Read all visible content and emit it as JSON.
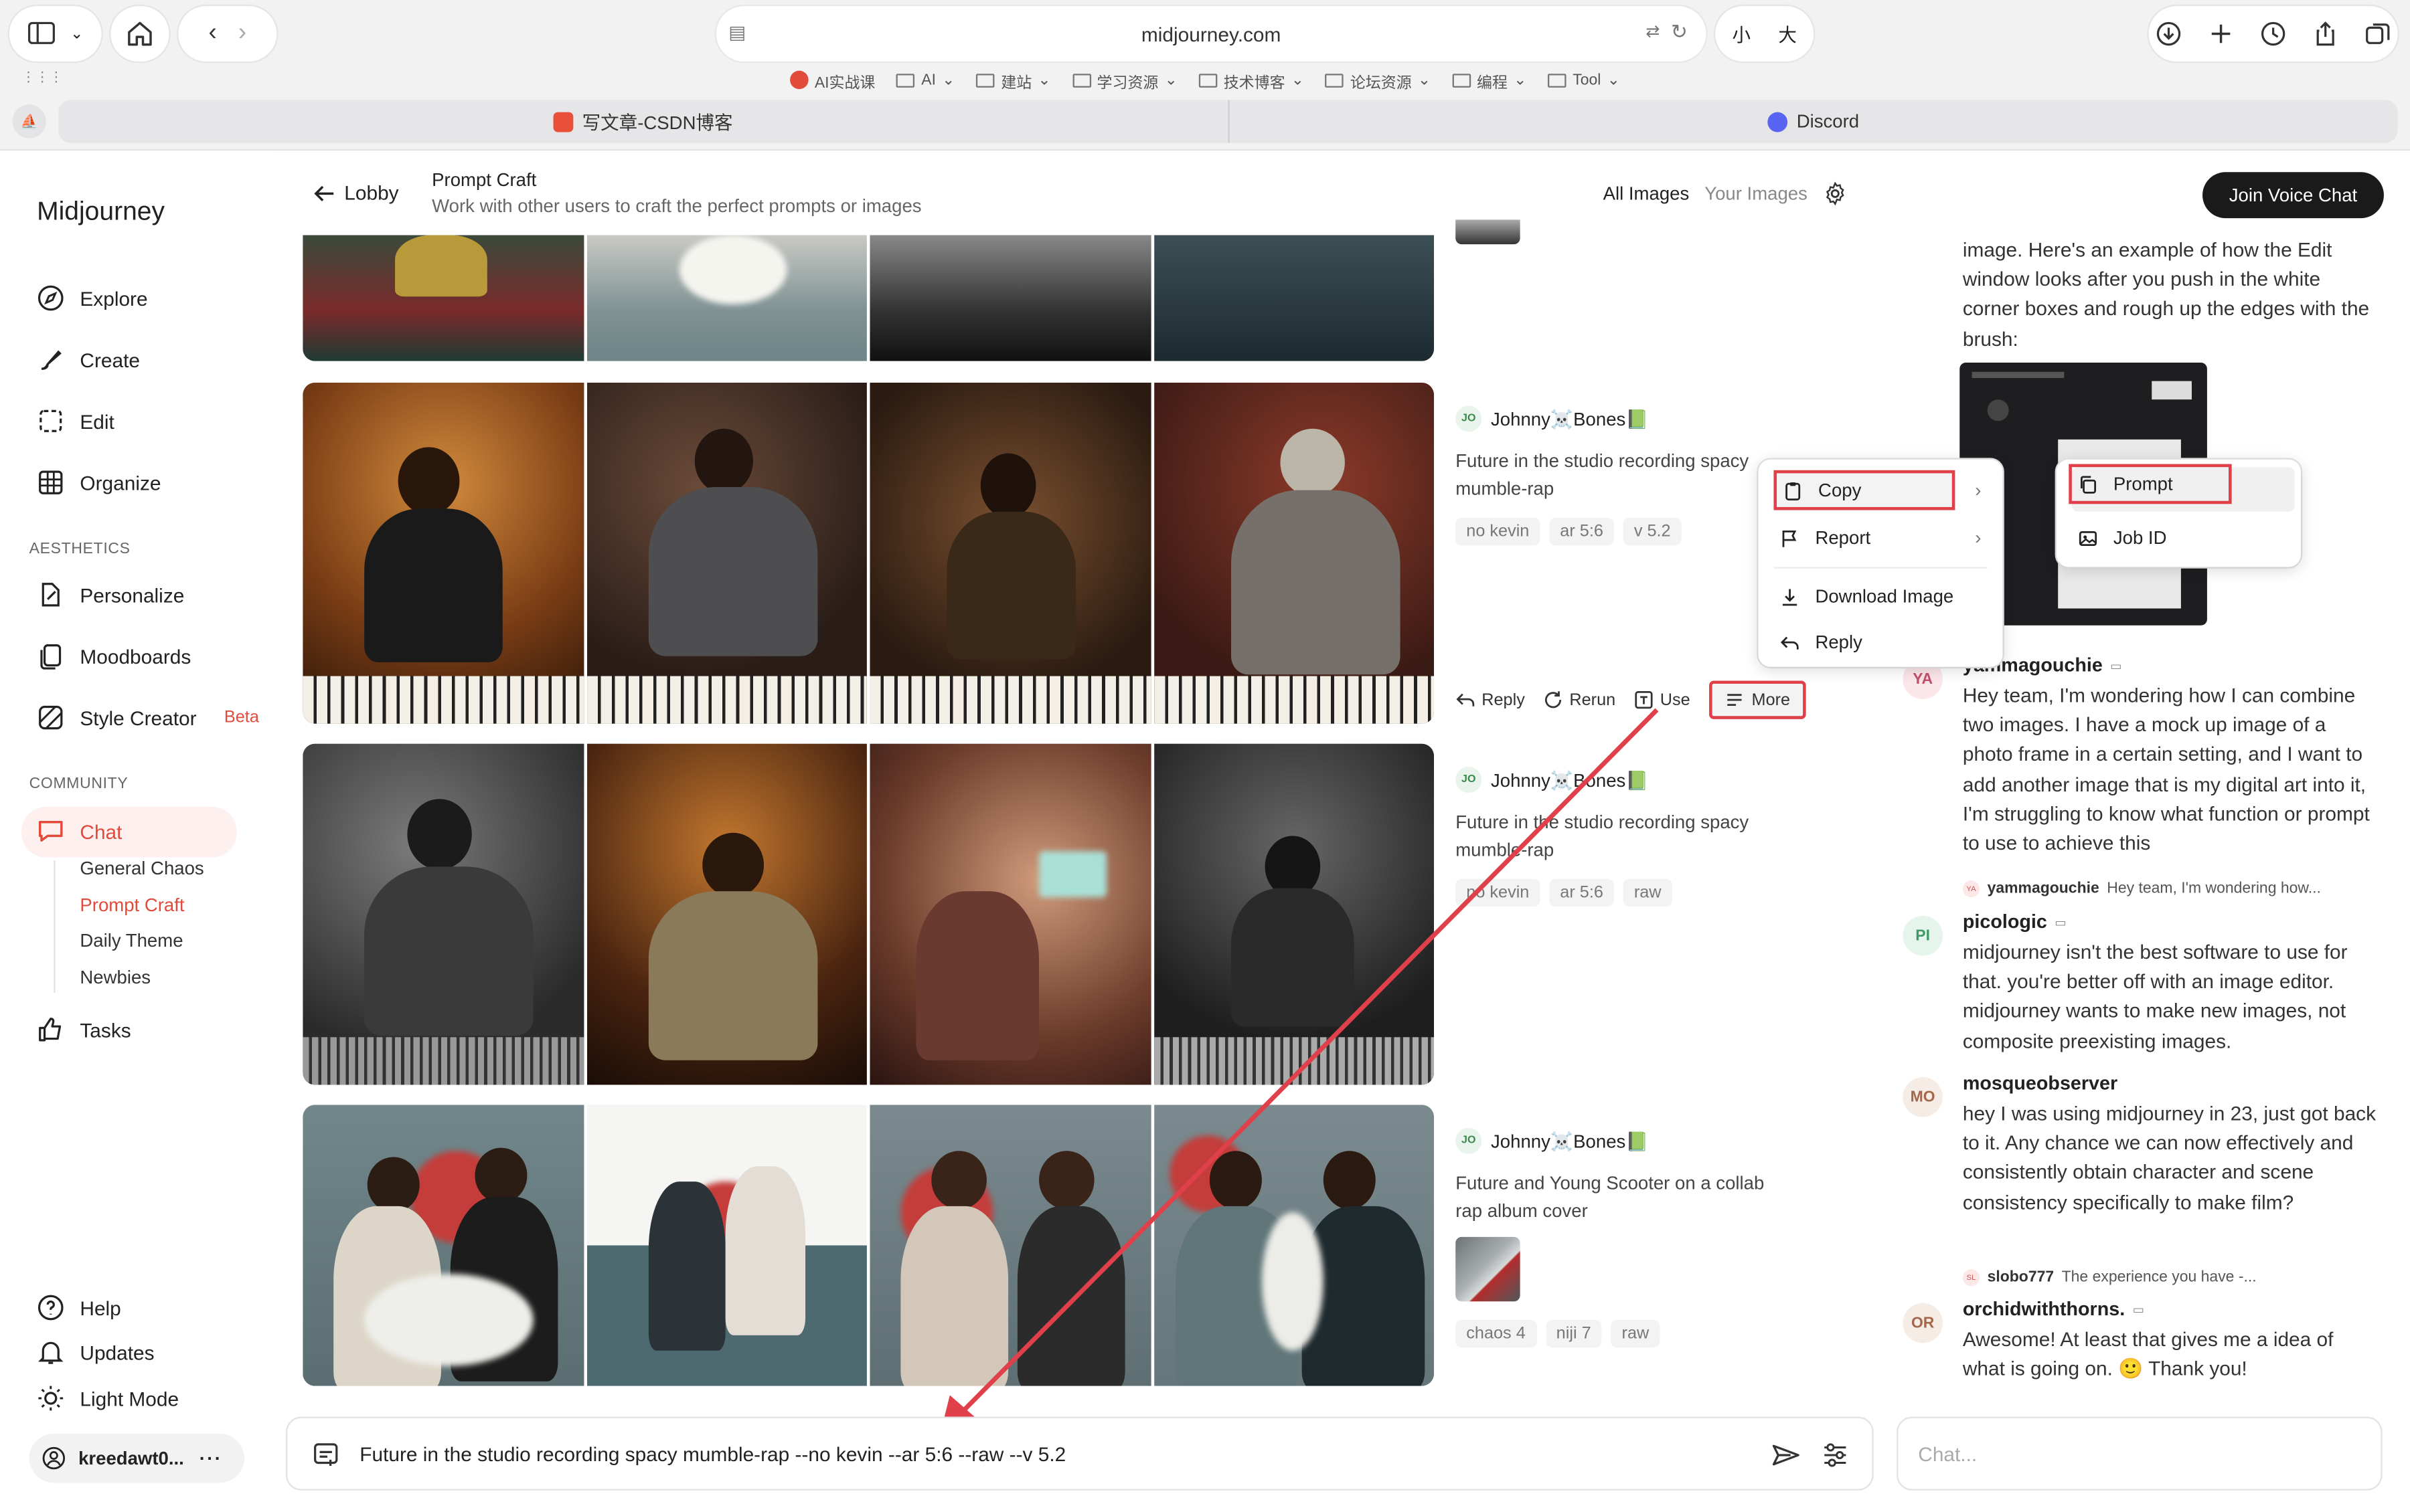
{
  "browser": {
    "url": "midjourney.com",
    "text_size_small": "小",
    "text_size_large": "大",
    "bookmarks": [
      "AI实战课",
      "AI",
      "建站",
      "学习资源",
      "技术博客",
      "论坛资源",
      "编程",
      "Tool"
    ],
    "tabs": [
      {
        "label": "写文章-CSDN博客",
        "color": "#e8503a"
      },
      {
        "label": "Discord",
        "color": "#5865f2"
      }
    ]
  },
  "sidebar": {
    "logo": "Midjourney",
    "nav": [
      "Explore",
      "Create",
      "Edit",
      "Organize"
    ],
    "aesthetics_title": "AESTHETICS",
    "aesthetics": [
      "Personalize",
      "Moodboards",
      "Style Creator"
    ],
    "beta": "Beta",
    "community_title": "COMMUNITY",
    "chat": "Chat",
    "rooms": [
      "General Chaos",
      "Prompt Craft",
      "Daily Theme",
      "Newbies"
    ],
    "tasks": "Tasks",
    "bottom": [
      "Help",
      "Updates",
      "Light Mode"
    ],
    "account": "kreedawt0...",
    "accent": "#e24a3b"
  },
  "header": {
    "back": "Lobby",
    "title": "Prompt Craft",
    "subtitle": "Work with other users to craft the perfect prompts or images",
    "all_images": "All Images",
    "your_images": "Your Images",
    "join": "Join Voice Chat"
  },
  "posts": [
    {
      "author": "Johnny☠️Bones📗",
      "avatar": "JO",
      "prompt": "Future in the studio recording spacy mumble-rap",
      "chips": [
        "no kevin",
        "ar 5:6",
        "v 5.2"
      ]
    },
    {
      "author": "Johnny☠️Bones📗",
      "avatar": "JO",
      "prompt": "Future in the studio recording spacy mumble-rap",
      "chips": [
        "no kevin",
        "ar 5:6",
        "raw"
      ]
    },
    {
      "author": "Johnny☠️Bones📗",
      "avatar": "JO",
      "prompt": "Future and Young Scooter on a collab rap album cover",
      "chips": [
        "chaos 4",
        "niji 7",
        "raw"
      ]
    }
  ],
  "actions": {
    "reply": "Reply",
    "rerun": "Rerun",
    "use": "Use",
    "more": "More"
  },
  "menu": {
    "copy": "Copy",
    "report": "Report",
    "download": "Download Image",
    "reply": "Reply"
  },
  "submenu": {
    "prompt": "Prompt",
    "job_id": "Job ID"
  },
  "chat": {
    "intro": "image. Here's an example of how the Edit window looks after you push in the white corner boxes and rough up the edges with the brush:",
    "messages": [
      {
        "author": "yammagouchie",
        "avatar": "YA",
        "avatar_bg": "#fbe6ea",
        "avatar_fg": "#c2506b",
        "text": "Hey team, I'm wondering how I can combine two images. I have a mock up image of a photo frame in a certain setting, and I want to add another image that is my digital art into it, I'm struggling to know what function or prompt to use to achieve this"
      },
      {
        "author": "picologic",
        "avatar": "PI",
        "avatar_bg": "#e5f5ec",
        "avatar_fg": "#3d9a66",
        "reply_to": "yammagouchie",
        "reply_text": "Hey team, I'm wondering how...",
        "reply_avatar": "YA",
        "text": "midjourney isn't the best software to use for that. you're better off with an image editor. midjourney wants to make new images, not composite preexisting images."
      },
      {
        "author": "mosqueobserver",
        "avatar": "MO",
        "avatar_bg": "#f6ece6",
        "avatar_fg": "#a4674a",
        "text": "hey I was using midjourney in 23, just got back to it. Any chance we can now effectively and consistently obtain character and scene consistency specifically to make film?"
      },
      {
        "author": "orchidwiththorns.",
        "avatar": "OR",
        "avatar_bg": "#f6ece6",
        "avatar_fg": "#a4674a",
        "reply_to": "slobo777",
        "reply_text": "The experience you have -...",
        "reply_avatar": "SL",
        "text": "Awesome! At least that gives me a idea of what is going on. 🙂 Thank you!"
      }
    ],
    "placeholder": "Chat..."
  },
  "composer": {
    "text": "Future in the studio recording spacy mumble-rap --no kevin --ar 5:6 --raw --v 5.2"
  }
}
